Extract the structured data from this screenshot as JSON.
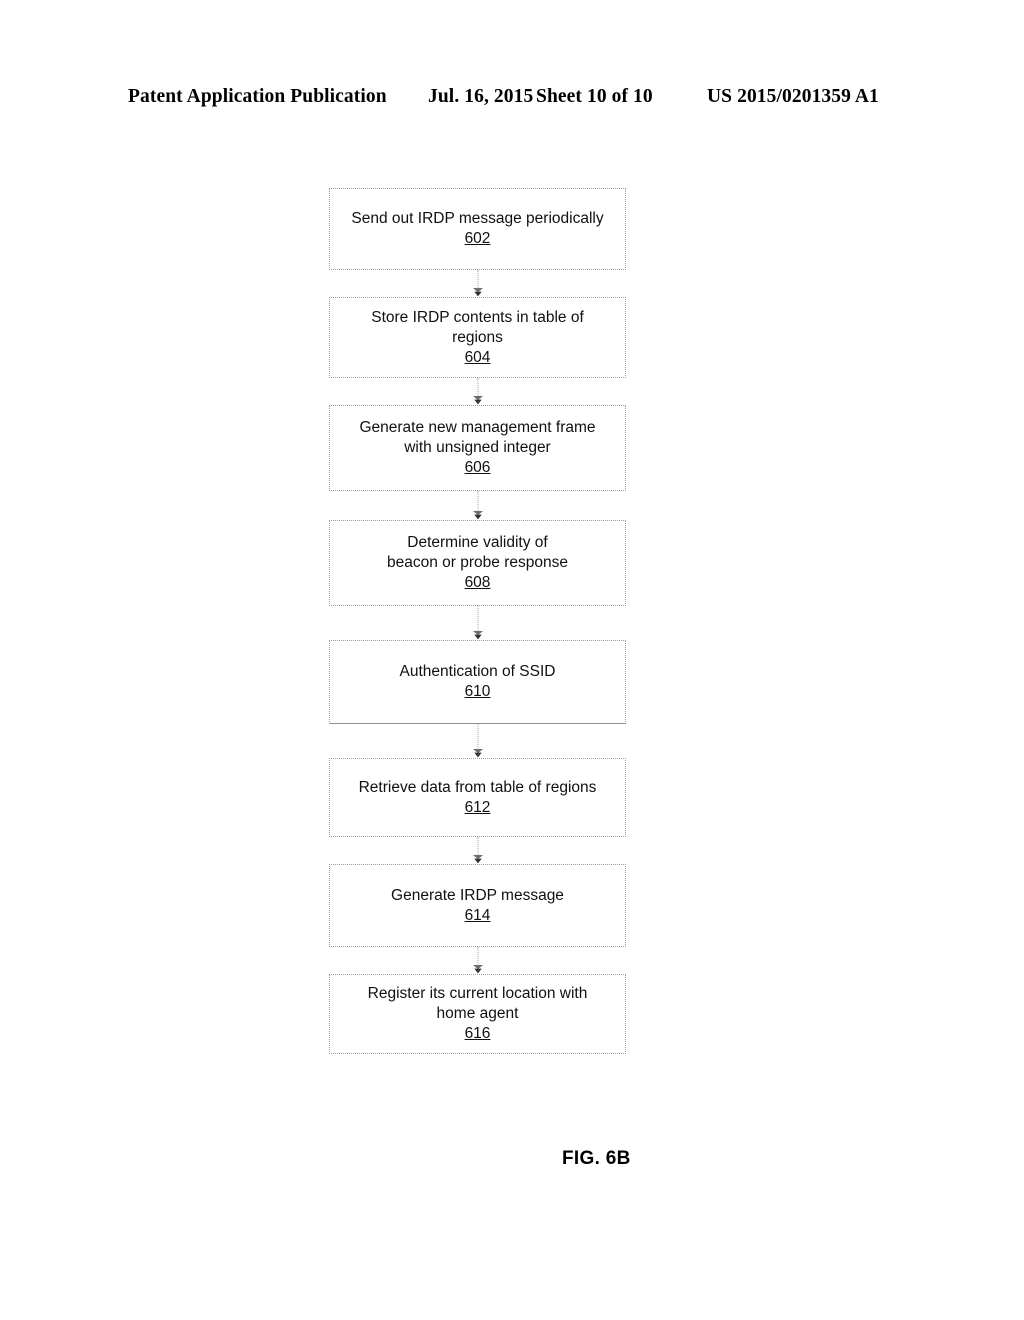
{
  "header": {
    "title": "Patent Application Publication",
    "date": "Jul. 16, 2015",
    "sheet": "Sheet 10 of 10",
    "publication_number": "US 2015/0201359 A1"
  },
  "figure": {
    "caption": "FIG. 6B",
    "type": "flowchart",
    "orientation": "vertical",
    "connector_glyph": "double-chevron-down-arrow",
    "border_style": "dotted",
    "border_color": "#9b9b9b",
    "text_color": "#111111",
    "background_color": "#ffffff"
  },
  "flowchart": {
    "nodes": [
      {
        "label": "Send out IRDP message periodically",
        "ref": "602"
      },
      {
        "label": "Store IRDP contents in table of\nregions",
        "ref": "604"
      },
      {
        "label": "Generate new management frame\nwith unsigned integer",
        "ref": "606"
      },
      {
        "label": "Determine validity of\nbeacon or probe response",
        "ref": "608"
      },
      {
        "label": "Authentication of SSID",
        "ref": "610"
      },
      {
        "label": "Retrieve data from table of regions",
        "ref": "612"
      },
      {
        "label": "Generate IRDP message",
        "ref": "614"
      },
      {
        "label": "Register its current location with\nhome agent",
        "ref": "616"
      }
    ]
  }
}
